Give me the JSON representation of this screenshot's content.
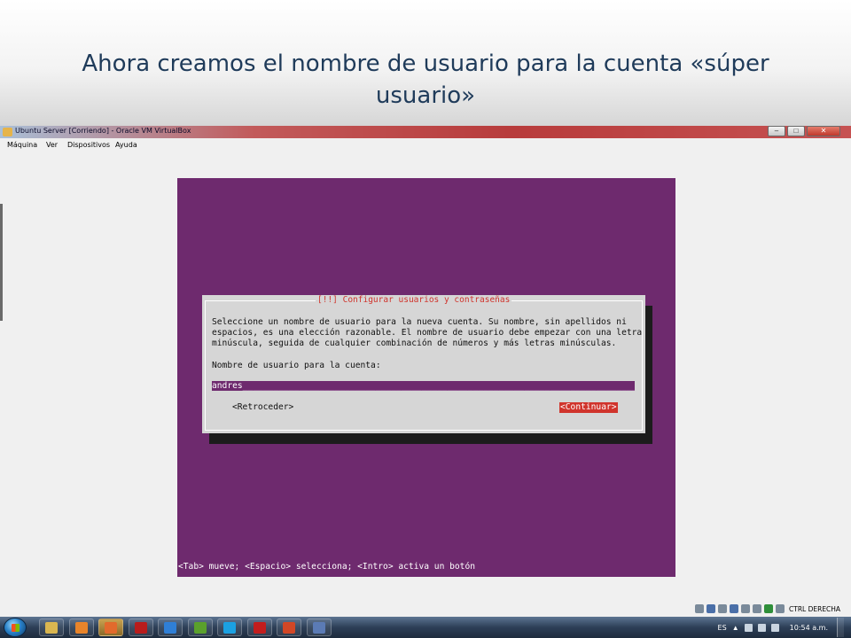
{
  "slide": {
    "title": "Ahora creamos el nombre de usuario para la cuenta «súper usuario»"
  },
  "window": {
    "title": "Ubuntu Server [Corriendo] - Oracle VM VirtualBox",
    "minimize": "–",
    "maximize": "□",
    "close": "✕"
  },
  "menu": {
    "items": [
      "Máquina",
      "Ver",
      "Dispositivos",
      "Ayuda"
    ]
  },
  "dialog": {
    "title": "[!!] Configurar usuarios y contraseñas",
    "description": "Seleccione un nombre de usuario para la nueva cuenta. Su nombre, sin apellidos ni\nespacios, es una elección razonable. El nombre de usuario debe empezar con una letra\nminúscula, seguida de cualquier combinación de números y más letras minúsculas.",
    "field_label": "Nombre de usuario para la cuenta:",
    "field_value": "andres",
    "back_button": "<Retroceder>",
    "continue_button": "<Continuar>"
  },
  "guest_status": "<Tab> mueve; <Espacio> selecciona; <Intro> activa un botón",
  "vbox_status": {
    "host_key": "CTRL DERECHA"
  },
  "taskbar": {
    "language": "ES",
    "clock": "10:54 a.m.",
    "show_hidden": "▲",
    "apps": [
      {
        "icon": "folder-icon",
        "color": "#d9b650"
      },
      {
        "icon": "media-player-icon",
        "color": "#e8842a"
      },
      {
        "icon": "firefox-icon",
        "color": "#e26a2c"
      },
      {
        "icon": "flash-icon",
        "color": "#b81c1c"
      },
      {
        "icon": "ie-icon",
        "color": "#2f7fd6"
      },
      {
        "icon": "dreamweaver-icon",
        "color": "#5aa02c"
      },
      {
        "icon": "skype-icon",
        "color": "#1ba1e2"
      },
      {
        "icon": "acrobat-icon",
        "color": "#c21d1d"
      },
      {
        "icon": "powerpoint-icon",
        "color": "#d24726"
      },
      {
        "icon": "virtualbox-icon",
        "color": "#5b7bb5"
      }
    ]
  }
}
